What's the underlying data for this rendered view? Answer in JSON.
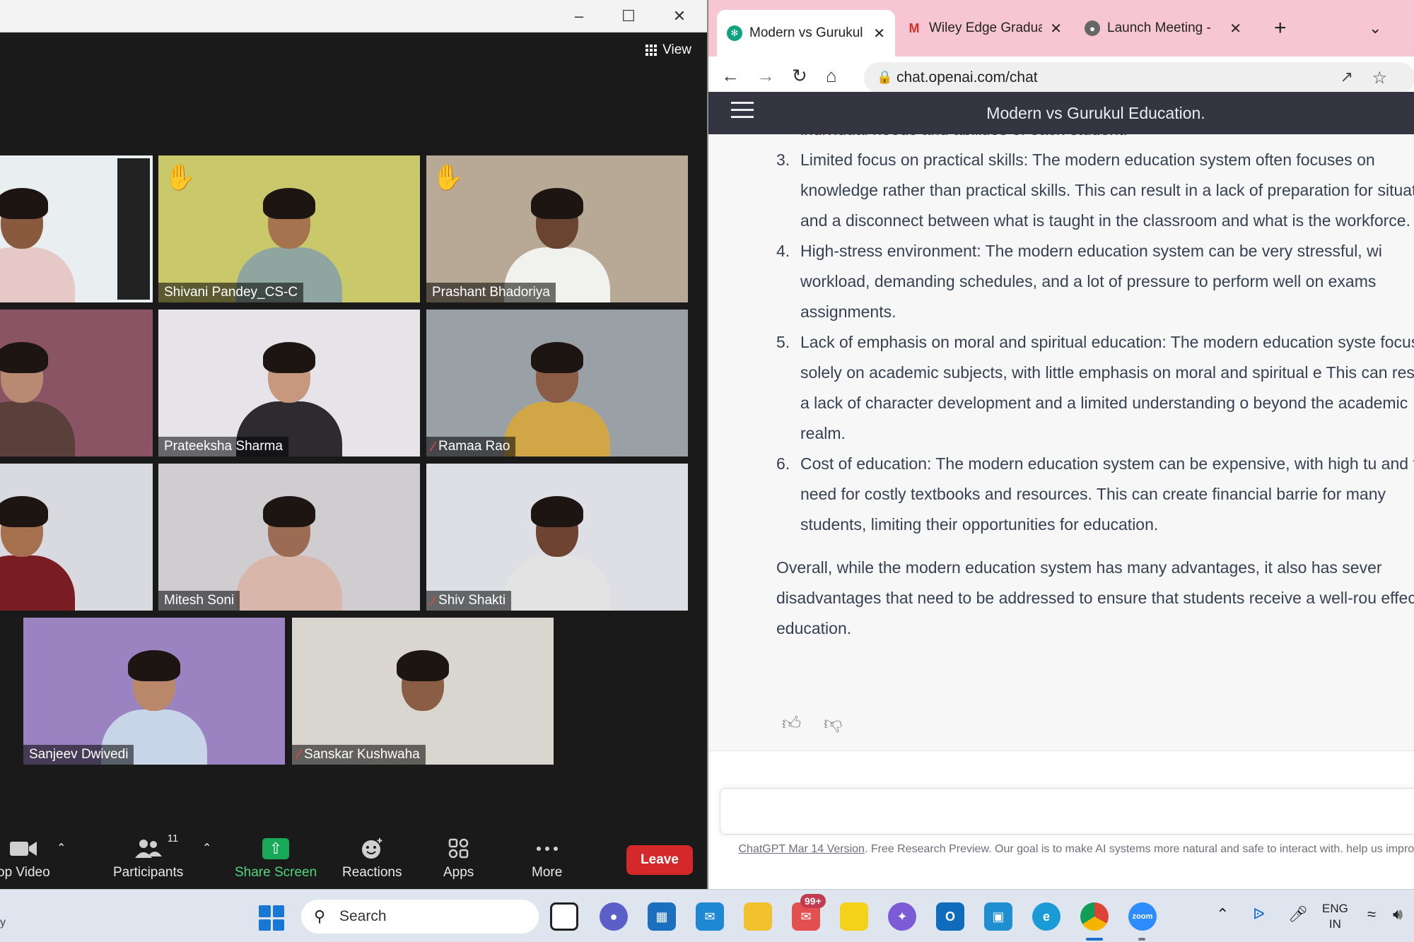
{
  "zoom": {
    "view_label": "View",
    "participants": [
      {
        "name": "",
        "hand": false,
        "muted": false,
        "active": true,
        "bg": "#e9eef0",
        "skin": "#8a5a3f",
        "shirt": "#e6c9c6"
      },
      {
        "name": "Shivani Pandey_CS-C",
        "hand": true,
        "muted": false,
        "active": false,
        "bg": "#c9c86a",
        "skin": "#a6734f",
        "shirt": "#8fa6a0"
      },
      {
        "name": "Prashant Bhadoriya",
        "hand": true,
        "muted": false,
        "active": false,
        "bg": "#b8a896",
        "skin": "#6a4430",
        "shirt": "#f1f1ee"
      },
      {
        "name": "",
        "hand": false,
        "muted": false,
        "active": false,
        "bg": "#8a5464",
        "skin": "#b98a72",
        "shirt": "#5a3f3a"
      },
      {
        "name": "Prateeksha Sharma",
        "hand": false,
        "muted": false,
        "active": false,
        "bg": "#e6e4e8",
        "skin": "#c8987e",
        "shirt": "#2d2a30"
      },
      {
        "name": "Ramaa Rao",
        "hand": false,
        "muted": true,
        "active": false,
        "bg": "#9aa1a6",
        "skin": "#8a5c45",
        "shirt": "#d1a646"
      },
      {
        "name": "",
        "hand": false,
        "muted": false,
        "active": false,
        "bg": "#d8dadf",
        "skin": "#a6714f",
        "shirt": "#7a1d22"
      },
      {
        "name": "Mitesh Soni",
        "hand": false,
        "muted": false,
        "active": false,
        "bg": "#cfcdd0",
        "skin": "#9b6b53",
        "shirt": "#d9b6aa"
      },
      {
        "name": "Shiv Shakti",
        "hand": false,
        "muted": true,
        "active": false,
        "bg": "#dddfe4",
        "skin": "#6e4331",
        "shirt": "#e3e3e3"
      },
      {
        "name": "Sanjeev Dwivedi",
        "hand": false,
        "muted": false,
        "active": false,
        "bg": "#9a83c0",
        "skin": "#b9876a",
        "shirt": "#c8d4e8"
      },
      {
        "name": "Sanskar Kushwaha",
        "hand": false,
        "muted": true,
        "active": false,
        "bg": "#d9d6d0",
        "skin": "#8a5e45",
        "shirt": "#d9d6cf"
      }
    ],
    "toolbar": {
      "video_label": "op Video",
      "participants_label": "Participants",
      "participants_count": "11",
      "share_label": "Share Screen",
      "reactions_label": "Reactions",
      "apps_label": "Apps",
      "more_label": "More",
      "leave_label": "Leave"
    }
  },
  "chrome": {
    "tabs": [
      {
        "title": "Modern vs Gurukul",
        "icon": "openai-icon"
      },
      {
        "title": "Wiley Edge Gradua",
        "icon": "gmail-icon"
      },
      {
        "title": "Launch Meeting - ",
        "icon": "globe-icon"
      }
    ],
    "url": "chat.openai.com/chat",
    "page_title": "Modern vs Gurukul Education.",
    "fragment_top": "individual needs and abilities of each student.",
    "items": [
      {
        "num": "3.",
        "text": "Limited focus on practical skills: The modern education system often focuses on knowledge rather than practical skills. This can result in a lack of preparation for situations and a disconnect between what is taught in the classroom and what is the workforce."
      },
      {
        "num": "4.",
        "text": "High-stress environment: The modern education system can be very stressful, wi workload, demanding schedules, and a lot of pressure to perform well on exams assignments."
      },
      {
        "num": "5.",
        "text": "Lack of emphasis on moral and spiritual education: The modern education syste focuses solely on academic subjects, with little emphasis on moral and spiritual e This can result in a lack of character development and a limited understanding o beyond the academic realm."
      },
      {
        "num": "6.",
        "text": "Cost of education: The modern education system can be expensive, with high tu and the need for costly textbooks and resources. This can create financial barrie for many students, limiting their opportunities for education."
      }
    ],
    "summary": "Overall, while the modern education system has many advantages, it also has sever disadvantages that need to be addressed to ensure that students receive a well-rou effective education.",
    "footer_link": "ChatGPT Mar 14 Version",
    "footer_text": ". Free Research Preview. Our goal is to make AI systems more natural and safe to interact with. help us improve."
  },
  "taskbar": {
    "search_placeholder": "Search",
    "mail_badge": "99+",
    "lang_line1": "ENG",
    "lang_line2": "IN",
    "left_fragment": "y"
  }
}
